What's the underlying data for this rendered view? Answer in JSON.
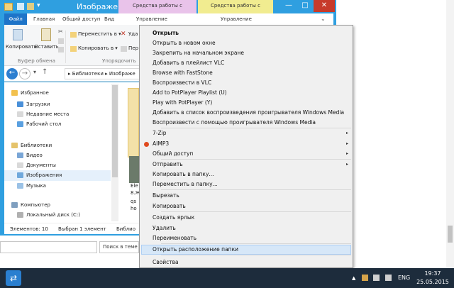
{
  "window": {
    "title": "Изображения",
    "context_tab_1": "Средства работы с библиотекой",
    "context_tab_2": "Средства работы с рисунками",
    "minimize": "—",
    "maximize": "□",
    "close": "✕",
    "tabs": [
      "Файл",
      "Главная",
      "Общий доступ",
      "Вид",
      "Управление",
      "Управление"
    ]
  },
  "ribbon": {
    "copy": "Копировать",
    "paste": "Вставить",
    "move_to": "Переместить в ▾",
    "copy_to": "Копировать в ▾",
    "del_frag": "Уда",
    "ren_frag": "Пер",
    "group_clipboard": "Буфер обмена",
    "group_organize": "Упорядочить"
  },
  "nav": {
    "back": "←",
    "forward": "→",
    "up": "↑",
    "address": "▸  Библиотеки ▸ Изображе"
  },
  "navpane": {
    "items": [
      {
        "label": "Избранное",
        "color": "#f2c14e"
      },
      {
        "label": "Загрузки",
        "color": "#4a90d9"
      },
      {
        "label": "Недавние места",
        "color": "#d9d9d9"
      },
      {
        "label": "Рабочий стол",
        "color": "#5aa0e0"
      },
      {
        "label": "Библиотеки",
        "color": "#e5c36b"
      },
      {
        "label": "Видео",
        "color": "#7aa6d6"
      },
      {
        "label": "Документы",
        "color": "#d9d9d9"
      },
      {
        "label": "Изображения",
        "color": "#6fa8dc"
      },
      {
        "label": "Музыка",
        "color": "#9bc2e6"
      },
      {
        "label": "Компьютер",
        "color": "#7f9fbf"
      },
      {
        "label": "Локальный диск (C:)",
        "color": "#b0b0b0"
      }
    ]
  },
  "content": {
    "frag1": "Ele",
    "frag2": "8.Ж",
    "frag3": "qs",
    "frag4": "ho"
  },
  "status": {
    "items_count": "Элементов: 10",
    "selected": "Выбран 1 элемент",
    "lib_frag": "Библио"
  },
  "search": {
    "placeholder": "Поиск в теме"
  },
  "context_menu": {
    "items": [
      {
        "label": "Открыть",
        "bold": true
      },
      {
        "label": "Открыть в новом окне"
      },
      {
        "label": "Закрепить на начальном экране"
      },
      {
        "label": "Добавить в плейлист VLC"
      },
      {
        "label": "Browse with FastStone"
      },
      {
        "label": "Воспроизвести в VLC"
      },
      {
        "label": "Add to PotPlayer Playlist (U)"
      },
      {
        "label": "Play with PotPlayer (Y)"
      },
      {
        "label": "Добавить в список воспроизведения проигрывателя Windows Media"
      },
      {
        "label": "Воспроизвести с помощью проигрывателя Windows Media"
      },
      {
        "label": "7-Zip",
        "submenu": true
      },
      {
        "label": "AIMP3",
        "submenu": true,
        "icon": "aimp-icon"
      },
      {
        "label": "Общий доступ",
        "submenu": true
      },
      {
        "label": "Отправить",
        "submenu": true
      },
      {
        "label": "Копировать в папку..."
      },
      {
        "label": "Переместить в папку..."
      },
      {
        "label": "Вырезать"
      },
      {
        "label": "Копировать"
      },
      {
        "label": "Создать ярлык"
      },
      {
        "label": "Удалить"
      },
      {
        "label": "Переименовать"
      },
      {
        "label": "Открыть расположение папки",
        "highlighted": true
      },
      {
        "label": "Свойства"
      }
    ],
    "submenu_arrow": "▸"
  },
  "taskbar": {
    "tray_arrow": "▲",
    "lang": "ENG",
    "time": "19:37",
    "date": "25.05.2015"
  }
}
